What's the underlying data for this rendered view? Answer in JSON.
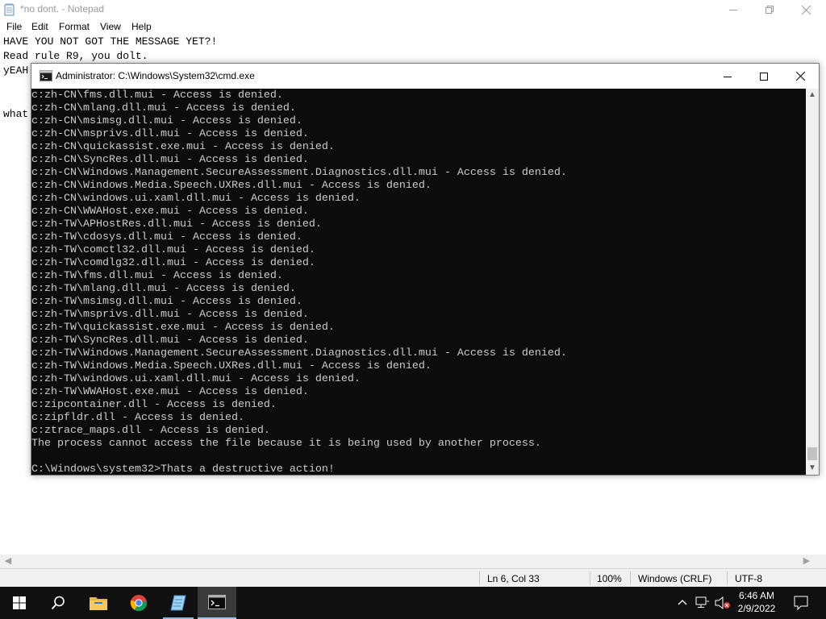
{
  "notepad": {
    "title": "*no dont. - Notepad",
    "menu": [
      "File",
      "Edit",
      "Format",
      "View",
      "Help"
    ],
    "lines": [
      "HAVE YOU NOT GOT THE MESSAGE YET?!",
      "Read rule R9, you dolt.",
      "yEAH",
      "",
      "what"
    ],
    "status": {
      "position": "Ln 6, Col 33",
      "zoom": "100%",
      "line_ending": "Windows (CRLF)",
      "encoding": "UTF-8"
    }
  },
  "cmd": {
    "title": "Administrator: C:\\Windows\\System32\\cmd.exe",
    "lines": [
      "c:zh-CN\\fms.dll.mui - Access is denied.",
      "c:zh-CN\\mlang.dll.mui - Access is denied.",
      "c:zh-CN\\msimsg.dll.mui - Access is denied.",
      "c:zh-CN\\msprivs.dll.mui - Access is denied.",
      "c:zh-CN\\quickassist.exe.mui - Access is denied.",
      "c:zh-CN\\SyncRes.dll.mui - Access is denied.",
      "c:zh-CN\\Windows.Management.SecureAssessment.Diagnostics.dll.mui - Access is denied.",
      "c:zh-CN\\Windows.Media.Speech.UXRes.dll.mui - Access is denied.",
      "c:zh-CN\\windows.ui.xaml.dll.mui - Access is denied.",
      "c:zh-CN\\WWAHost.exe.mui - Access is denied.",
      "c:zh-TW\\APHostRes.dll.mui - Access is denied.",
      "c:zh-TW\\cdosys.dll.mui - Access is denied.",
      "c:zh-TW\\comctl32.dll.mui - Access is denied.",
      "c:zh-TW\\comdlg32.dll.mui - Access is denied.",
      "c:zh-TW\\fms.dll.mui - Access is denied.",
      "c:zh-TW\\mlang.dll.mui - Access is denied.",
      "c:zh-TW\\msimsg.dll.mui - Access is denied.",
      "c:zh-TW\\msprivs.dll.mui - Access is denied.",
      "c:zh-TW\\quickassist.exe.mui - Access is denied.",
      "c:zh-TW\\SyncRes.dll.mui - Access is denied.",
      "c:zh-TW\\Windows.Management.SecureAssessment.Diagnostics.dll.mui - Access is denied.",
      "c:zh-TW\\Windows.Media.Speech.UXRes.dll.mui - Access is denied.",
      "c:zh-TW\\windows.ui.xaml.dll.mui - Access is denied.",
      "c:zh-TW\\WWAHost.exe.mui - Access is denied.",
      "c:zipcontainer.dll - Access is denied.",
      "c:zipfldr.dll - Access is denied.",
      "c:ztrace_maps.dll - Access is denied.",
      "The process cannot access the file because it is being used by another process.",
      "",
      "C:\\Windows\\system32>Thats a destructive action!"
    ]
  },
  "taskbar": {
    "time": "6:46 AM",
    "date": "2/9/2022",
    "apps": [
      "start-icon",
      "search-icon",
      "file-explorer-icon",
      "chrome-icon",
      "notepad-icon",
      "cmd-icon"
    ]
  },
  "colors": {
    "console_bg": "#0c0c0c",
    "console_text": "#cccccc",
    "taskbar_bg": "#101010",
    "accent": "#0078d7"
  }
}
